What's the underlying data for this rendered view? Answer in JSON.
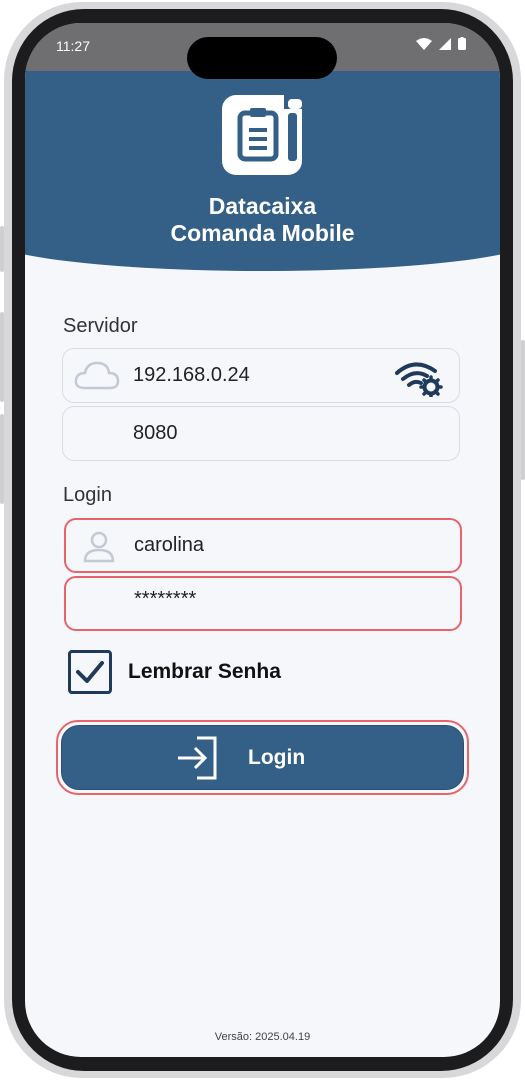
{
  "status_bar": {
    "time": "11:27"
  },
  "app": {
    "title_line1": "Datacaixa",
    "title_line2": "Comanda Mobile"
  },
  "server": {
    "section_label": "Servidor",
    "ip_value": "192.168.0.24",
    "port_value": "8080"
  },
  "login": {
    "section_label": "Login",
    "username_value": "carolina",
    "password_value": "********",
    "remember_label": "Lembrar Senha",
    "remember_checked": true,
    "button_label": "Login"
  },
  "footer": {
    "version": "Versão: 2025.04.19"
  },
  "colors": {
    "primary": "#346088",
    "error_outline": "#e7646a",
    "background": "#f5f7fb"
  }
}
